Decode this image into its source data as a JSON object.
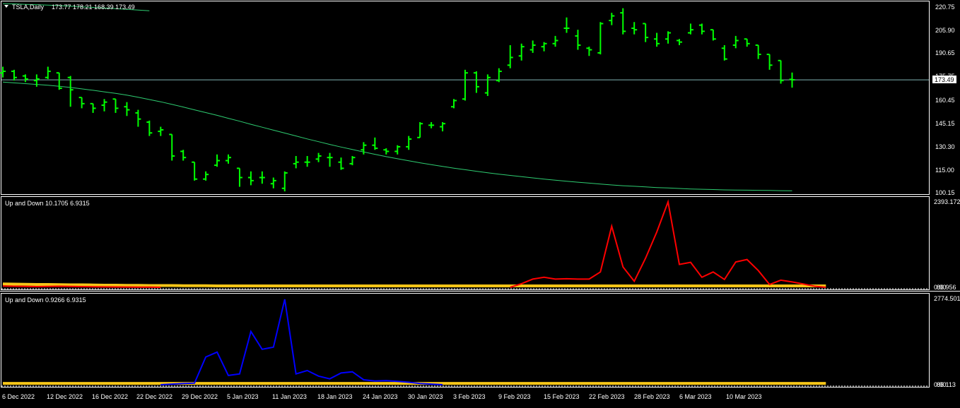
{
  "window": {
    "symbol_label": "TSLA,Daily",
    "ohlc_text": "173.77 178.21 168.39 173.49",
    "last_price_label": "173.49"
  },
  "colors": {
    "background": "#000000",
    "frame": "#ffffff",
    "bars": "#00ff00",
    "moving_average": "#2ecc71",
    "bid_line": "#7fb3b3",
    "indicator1_line": "#ff0000",
    "indicator2_line": "#0000ff",
    "baseline": "#f5c518"
  },
  "x_axis_labels": [
    "6 Dec 2022",
    "12 Dec 2022",
    "16 Dec 2022",
    "22 Dec 2022",
    "29 Dec 2022",
    "5 Jan 2023",
    "11 Jan 2023",
    "18 Jan 2023",
    "24 Jan 2023",
    "30 Jan 2023",
    "3 Feb 2023",
    "9 Feb 2023",
    "15 Feb 2023",
    "22 Feb 2023",
    "28 Feb 2023",
    "6 Mar 2023",
    "10 Mar 2023"
  ],
  "chart_data": [
    {
      "type": "ohlc",
      "title": "TSLA,Daily",
      "last": {
        "open": 173.77,
        "high": 178.21,
        "low": 168.39,
        "close": 173.49
      },
      "y_tick_labels": [
        "220.75",
        "205.90",
        "190.65",
        "175.75",
        "160.45",
        "145.15",
        "130.30",
        "115.00",
        "100.15"
      ],
      "ylim": [
        100.15,
        220.75
      ],
      "bid_price": 173.49,
      "bars": [
        {
          "o": 178,
          "h": 182,
          "l": 175,
          "c": 179
        },
        {
          "o": 179,
          "h": 180,
          "l": 173,
          "c": 175
        },
        {
          "o": 176,
          "h": 177,
          "l": 172,
          "c": 174
        },
        {
          "o": 173,
          "h": 177,
          "l": 169,
          "c": 174
        },
        {
          "o": 175,
          "h": 182,
          "l": 174,
          "c": 179
        },
        {
          "o": 178,
          "h": 178,
          "l": 167,
          "c": 168
        },
        {
          "o": 175,
          "h": 176,
          "l": 156,
          "c": 167
        },
        {
          "o": 162,
          "h": 162,
          "l": 155,
          "c": 158
        },
        {
          "o": 158,
          "h": 158,
          "l": 152,
          "c": 155
        },
        {
          "o": 157,
          "h": 161,
          "l": 153,
          "c": 159
        },
        {
          "o": 161,
          "h": 161,
          "l": 152,
          "c": 155
        },
        {
          "o": 156,
          "h": 159,
          "l": 150,
          "c": 154
        },
        {
          "o": 152,
          "h": 154,
          "l": 143,
          "c": 148
        },
        {
          "o": 146,
          "h": 147,
          "l": 137,
          "c": 139
        },
        {
          "o": 140,
          "h": 143,
          "l": 137,
          "c": 141
        },
        {
          "o": 138,
          "h": 138,
          "l": 121,
          "c": 124
        },
        {
          "o": 127,
          "h": 128,
          "l": 121,
          "c": 123
        },
        {
          "o": 120,
          "h": 120,
          "l": 108,
          "c": 109
        },
        {
          "o": 109,
          "h": 114,
          "l": 108,
          "c": 112
        },
        {
          "o": 118,
          "h": 125,
          "l": 117,
          "c": 121
        },
        {
          "o": 121,
          "h": 125,
          "l": 119,
          "c": 123
        },
        {
          "o": 116,
          "h": 116,
          "l": 104,
          "c": 110
        },
        {
          "o": 110,
          "h": 114,
          "l": 105,
          "c": 108
        },
        {
          "o": 110,
          "h": 114,
          "l": 106,
          "c": 110
        },
        {
          "o": 106,
          "h": 110,
          "l": 103,
          "c": 108
        },
        {
          "o": 103,
          "h": 114,
          "l": 101,
          "c": 113
        },
        {
          "o": 119,
          "h": 124,
          "l": 116,
          "c": 120
        },
        {
          "o": 120,
          "h": 124,
          "l": 117,
          "c": 120
        },
        {
          "o": 122,
          "h": 126,
          "l": 120,
          "c": 124
        },
        {
          "o": 123,
          "h": 126,
          "l": 117,
          "c": 123
        },
        {
          "o": 120,
          "h": 123,
          "l": 115,
          "c": 116
        },
        {
          "o": 119,
          "h": 124,
          "l": 118,
          "c": 123
        },
        {
          "o": 128,
          "h": 133,
          "l": 125,
          "c": 131
        },
        {
          "o": 131,
          "h": 136,
          "l": 128,
          "c": 129
        },
        {
          "o": 128,
          "h": 129,
          "l": 125,
          "c": 127
        },
        {
          "o": 127,
          "h": 131,
          "l": 125,
          "c": 130
        },
        {
          "o": 130,
          "h": 137,
          "l": 128,
          "c": 135
        },
        {
          "o": 136,
          "h": 146,
          "l": 136,
          "c": 145
        },
        {
          "o": 144,
          "h": 146,
          "l": 142,
          "c": 144
        },
        {
          "o": 143,
          "h": 146,
          "l": 140,
          "c": 145
        },
        {
          "o": 156,
          "h": 161,
          "l": 155,
          "c": 160
        },
        {
          "o": 161,
          "h": 180,
          "l": 160,
          "c": 178
        },
        {
          "o": 178,
          "h": 179,
          "l": 165,
          "c": 169
        },
        {
          "o": 165,
          "h": 177,
          "l": 163,
          "c": 175
        },
        {
          "o": 173,
          "h": 181,
          "l": 172,
          "c": 179
        },
        {
          "o": 183,
          "h": 196,
          "l": 181,
          "c": 188
        },
        {
          "o": 189,
          "h": 197,
          "l": 186,
          "c": 195
        },
        {
          "o": 193,
          "h": 199,
          "l": 191,
          "c": 196
        },
        {
          "o": 195,
          "h": 198,
          "l": 192,
          "c": 197
        },
        {
          "o": 197,
          "h": 202,
          "l": 195,
          "c": 199
        },
        {
          "o": 207,
          "h": 214,
          "l": 204,
          "c": 207
        },
        {
          "o": 202,
          "h": 206,
          "l": 193,
          "c": 196
        },
        {
          "o": 194,
          "h": 195,
          "l": 189,
          "c": 193
        },
        {
          "o": 191,
          "h": 211,
          "l": 190,
          "c": 210
        },
        {
          "o": 212,
          "h": 217,
          "l": 209,
          "c": 215
        },
        {
          "o": 217,
          "h": 220,
          "l": 203,
          "c": 205
        },
        {
          "o": 207,
          "h": 211,
          "l": 203,
          "c": 206
        },
        {
          "o": 210,
          "h": 210,
          "l": 198,
          "c": 201
        },
        {
          "o": 200,
          "h": 204,
          "l": 195,
          "c": 197
        },
        {
          "o": 200,
          "h": 205,
          "l": 197,
          "c": 204
        },
        {
          "o": 199,
          "h": 200,
          "l": 196,
          "c": 198
        },
        {
          "o": 204,
          "h": 210,
          "l": 203,
          "c": 206
        },
        {
          "o": 209,
          "h": 210,
          "l": 203,
          "c": 205
        },
        {
          "o": 206,
          "h": 206,
          "l": 199,
          "c": 200
        },
        {
          "o": 194,
          "h": 196,
          "l": 186,
          "c": 187
        },
        {
          "o": 196,
          "h": 202,
          "l": 194,
          "c": 199
        },
        {
          "o": 200,
          "h": 200,
          "l": 195,
          "c": 197
        },
        {
          "o": 196,
          "h": 196,
          "l": 187,
          "c": 190
        },
        {
          "o": 190,
          "h": 190,
          "l": 180,
          "c": 183
        },
        {
          "o": 186,
          "h": 186,
          "l": 171,
          "c": 173
        },
        {
          "o": 173.77,
          "h": 178.21,
          "l": 168.39,
          "c": 173.49
        }
      ],
      "moving_averages": [
        {
          "from_bar": 0,
          "values": [
            172,
            171.5,
            171,
            170.5,
            170,
            169.3,
            168.5,
            167.6,
            166.7,
            165.7,
            164.7,
            163.5,
            162.2,
            160.7,
            159.2,
            157.5,
            155.8,
            154,
            152.2,
            150.4,
            148.5,
            146.6,
            144.6,
            142.7,
            140.8,
            138.9,
            137,
            135.1,
            133.3,
            131.5,
            129.8,
            128.2,
            126.6,
            125.1,
            123.6,
            122.2,
            120.9,
            119.6,
            118.4,
            117.2,
            116.1,
            115.1,
            114.1,
            113.1,
            112.2,
            111.4,
            110.6,
            109.8,
            109,
            108.3,
            107.6,
            107,
            106.4,
            105.8,
            105.2,
            104.7,
            104.3,
            103.9,
            103.5,
            103.2,
            102.9,
            102.6,
            102.4,
            102.2,
            102,
            101.9,
            101.8,
            101.7,
            101.6,
            101.5,
            101.4
          ]
        },
        {
          "from_bar": 0,
          "values": [
            223,
            222.8,
            222.5,
            222.3,
            222,
            221.7,
            221.3,
            220.9,
            220.5,
            220.1,
            219.7,
            219.3,
            218.8,
            218.3
          ]
        }
      ]
    },
    {
      "type": "line",
      "title": "Up and Down 10.1705 6.9315",
      "y_tick_labels": [
        "2393.172",
        "86.956",
        "0.00"
      ],
      "ylim": [
        0,
        2393.172
      ],
      "series": [
        {
          "values": [
            35,
            30,
            25,
            20,
            25,
            30,
            25,
            20,
            15,
            12,
            10,
            8,
            5,
            3,
            0,
            0,
            0,
            0,
            0,
            0,
            0,
            0,
            0,
            0,
            0,
            0,
            0,
            0,
            0,
            0,
            0,
            0,
            0,
            0,
            0,
            0,
            0,
            0,
            0,
            0,
            0,
            0,
            0,
            0,
            0,
            0,
            100,
            230,
            280,
            230,
            240,
            230,
            230,
            430,
            1710,
            570,
            170,
            810,
            1550,
            2393.172,
            640,
            700,
            280,
            430,
            220,
            710,
            780,
            470,
            80,
            200,
            150,
            90,
            30,
            0
          ]
        },
        {
          "values": [
            75,
            70,
            65,
            60,
            60,
            55,
            50,
            50,
            45,
            40,
            40,
            35,
            35,
            30,
            30,
            30,
            25,
            25,
            25,
            20,
            20,
            20,
            20,
            20,
            20,
            20,
            20,
            20,
            20,
            20,
            20,
            20,
            20,
            20,
            20,
            20,
            20,
            20,
            20,
            20,
            20,
            20,
            20,
            20,
            20,
            20,
            20,
            20,
            20,
            20,
            20,
            20,
            20,
            20,
            20,
            20,
            20,
            20,
            20,
            20,
            20,
            20,
            20,
            20,
            20,
            20,
            20,
            20,
            20,
            20,
            20,
            20,
            20,
            20
          ]
        }
      ]
    },
    {
      "type": "line",
      "title": "Up and Down 0.9266 6.9315",
      "y_tick_labels": [
        "2774.501",
        "86.113",
        "0.00"
      ],
      "ylim": [
        0,
        2774.501
      ],
      "series": [
        {
          "values": [
            0,
            0,
            0,
            0,
            0,
            0,
            0,
            0,
            0,
            0,
            0,
            0,
            0,
            0,
            0,
            20,
            40,
            50,
            900,
            1060,
            300,
            350,
            1730,
            1150,
            1220,
            2774.501,
            350,
            460,
            280,
            190,
            380,
            420,
            160,
            120,
            130,
            110,
            80,
            40,
            20,
            0,
            0,
            0,
            0,
            0,
            0,
            0,
            0,
            0,
            0,
            0,
            0,
            0,
            0,
            0,
            0,
            0,
            0,
            0,
            0,
            0,
            0,
            0,
            0,
            0,
            0,
            0,
            0,
            0,
            0,
            0,
            0,
            0,
            0,
            0
          ]
        },
        {
          "values": [
            20,
            20,
            20,
            20,
            20,
            20,
            20,
            20,
            20,
            20,
            20,
            20,
            20,
            20,
            20,
            20,
            20,
            20,
            20,
            20,
            20,
            20,
            20,
            20,
            20,
            20,
            20,
            20,
            20,
            20,
            20,
            20,
            20,
            20,
            20,
            20,
            20,
            20,
            20,
            20,
            20,
            20,
            20,
            20,
            20,
            20,
            20,
            20,
            20,
            20,
            20,
            20,
            20,
            20,
            20,
            20,
            20,
            20,
            20,
            20,
            20,
            20,
            20,
            20,
            20,
            20,
            20,
            20,
            20,
            20,
            20,
            20,
            20,
            20
          ]
        }
      ]
    }
  ]
}
